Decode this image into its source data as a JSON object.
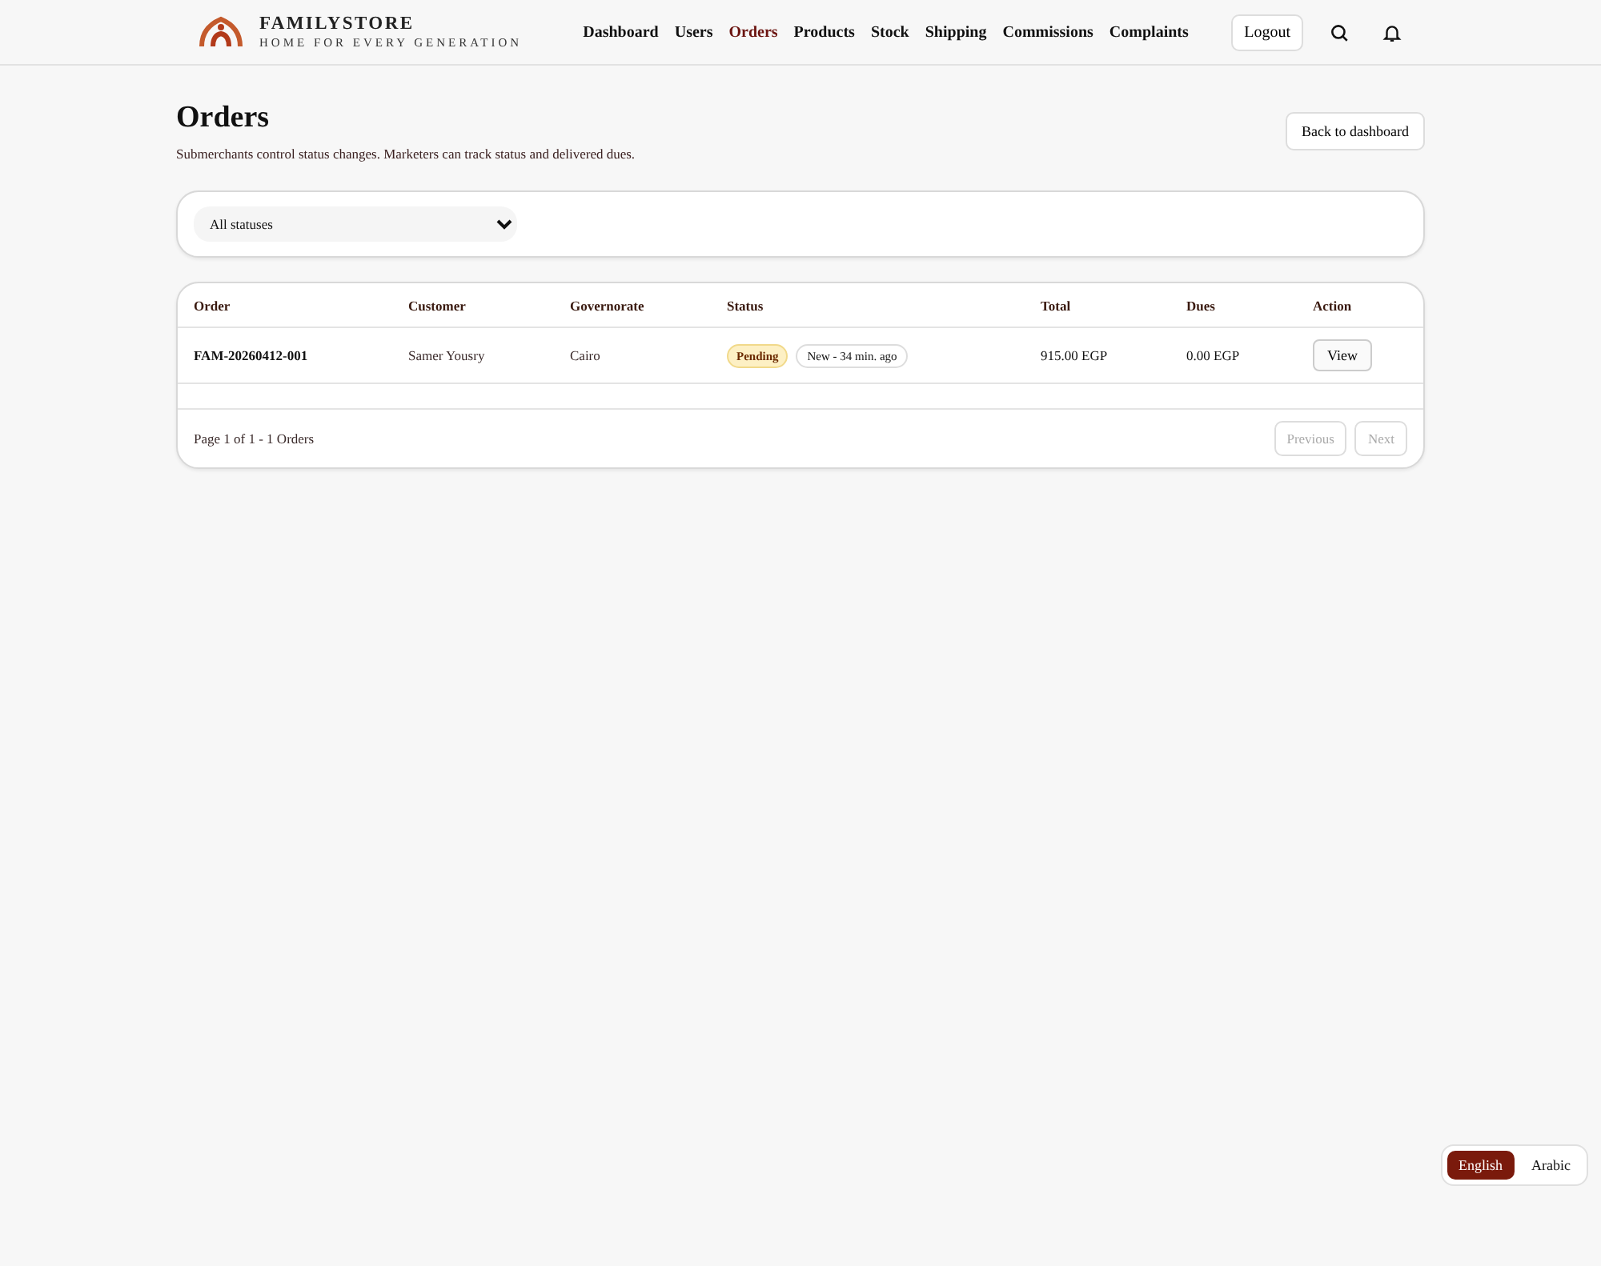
{
  "brand": {
    "name": "FAMILYSTORE",
    "tagline": "HOME FOR EVERY GENERATION"
  },
  "nav": [
    {
      "label": "Dashboard",
      "selected": false
    },
    {
      "label": "Users",
      "selected": false
    },
    {
      "label": "Orders",
      "selected": true
    },
    {
      "label": "Products",
      "selected": false
    },
    {
      "label": "Stock",
      "selected": false
    },
    {
      "label": "Shipping",
      "selected": false
    },
    {
      "label": "Commissions",
      "selected": false
    },
    {
      "label": "Complaints",
      "selected": false
    }
  ],
  "logout": "Logout",
  "page": {
    "title": "Orders",
    "subtitle": "Submerchants control status changes. Marketers can track status and delivered dues.",
    "back_button": "Back to dashboard"
  },
  "filter": {
    "value": "All statuses"
  },
  "table": {
    "columns": [
      "Order",
      "Customer",
      "Governorate",
      "Status",
      "Total",
      "Dues",
      "Action"
    ],
    "rows": [
      {
        "order": "FAM-20260412-001",
        "customer": "Samer Yousry",
        "governorate": "Cairo",
        "status": "Pending",
        "status_note": "New - 34 min. ago",
        "total": "915.00 EGP",
        "dues": "0.00 EGP",
        "action": "View"
      }
    ]
  },
  "pagination": {
    "summary": "Page 1 of 1 - 1 Orders",
    "buttons": [
      {
        "label": "Previous",
        "disabled": true
      },
      {
        "label": "Next",
        "disabled": true
      }
    ]
  },
  "languages": [
    {
      "label": "English",
      "selected": true
    },
    {
      "label": "Arabic",
      "selected": false
    }
  ]
}
